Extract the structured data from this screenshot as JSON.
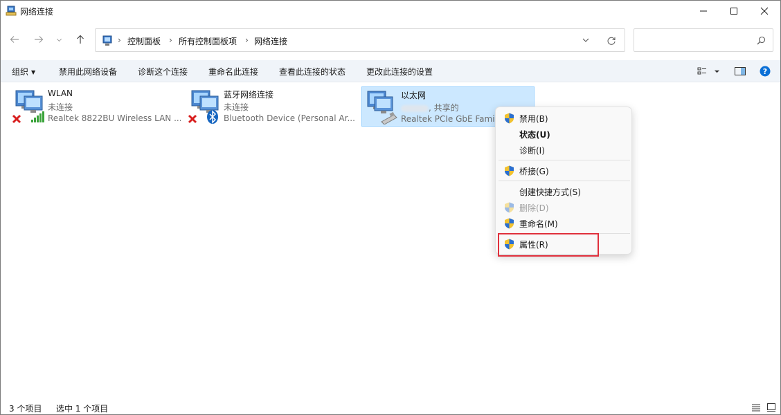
{
  "window": {
    "title": "网络连接"
  },
  "address": {
    "breadcrumbs": [
      "控制面板",
      "所有控制面板项",
      "网络连接"
    ],
    "search_placeholder": ""
  },
  "toolbar": {
    "organize": "组织",
    "disable": "禁用此网络设备",
    "diagnose": "诊断这个连接",
    "rename": "重命名此连接",
    "view_status": "查看此连接的状态",
    "change_settings": "更改此连接的设置"
  },
  "connections": [
    {
      "name": "WLAN",
      "status": "未连接",
      "device": "Realtek 8822BU Wireless LAN ..."
    },
    {
      "name": "蓝牙网络连接",
      "status": "未连接",
      "device": "Bluetooth Device (Personal Ar..."
    },
    {
      "name": "以太网",
      "status": ", 共享的",
      "device": "Realtek PCIe GbE Famil"
    }
  ],
  "context_menu": {
    "items": [
      {
        "label": "禁用(B)",
        "icon": "shield-icon"
      },
      {
        "label": "状态(U)"
      },
      {
        "label": "诊断(I)"
      },
      {
        "label": "桥接(G)",
        "icon": "shield-icon"
      },
      {
        "label": "创建快捷方式(S)"
      },
      {
        "label": "删除(D)",
        "icon": "shield-icon",
        "disabled": true
      },
      {
        "label": "重命名(M)",
        "icon": "shield-icon"
      },
      {
        "label": "属性(R)",
        "icon": "shield-icon"
      }
    ]
  },
  "status": {
    "count": "3 个项目",
    "selected": "选中 1 个项目"
  },
  "colors": {
    "selection": "#cce8ff",
    "highlight": "#e0303c",
    "help": "#0a6fd6"
  }
}
